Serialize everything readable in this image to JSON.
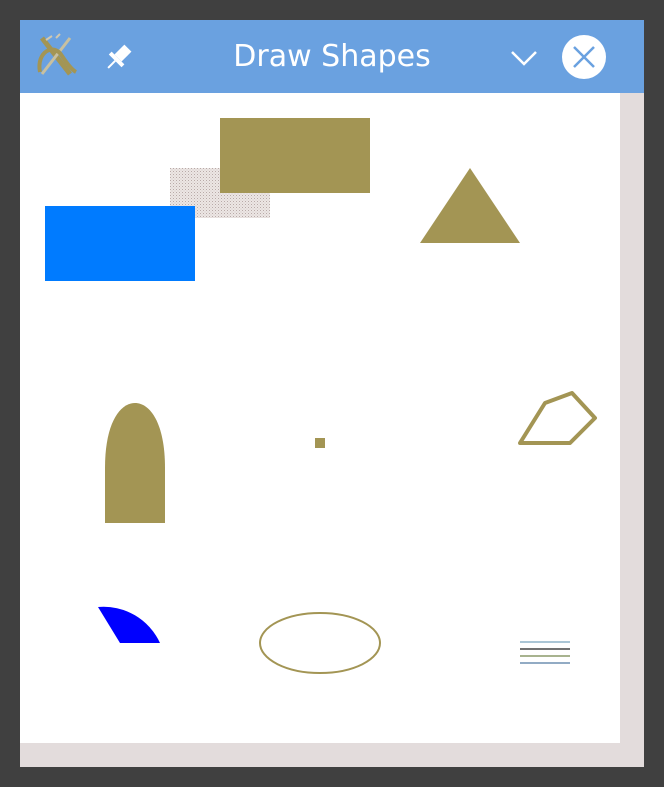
{
  "window": {
    "title": "Draw Shapes"
  },
  "titlebar": {
    "app_icon": "app-logo-icon",
    "pin_icon": "pin-icon",
    "collapse_icon": "chevron-down-icon",
    "close_icon": "close-icon"
  },
  "colors": {
    "titlebar": "#6aa1e0",
    "frame": "#e3dcdc",
    "canvas": "#ffffff",
    "olive": "#a39554",
    "blue": "#007bff",
    "pure_blue": "#0000ff",
    "stipple": "#e6dedd"
  },
  "shapes": [
    "filled-rectangle-olive",
    "stippled-rectangle",
    "filled-rectangle-blue",
    "filled-triangle",
    "filled-arch",
    "small-square-point",
    "outlined-pentagon",
    "filled-sector",
    "outlined-ellipse",
    "line-set"
  ]
}
